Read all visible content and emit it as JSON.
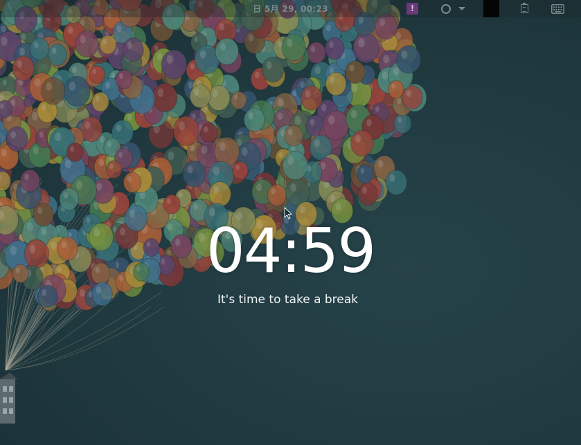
{
  "topbar": {
    "datetime": "日 5月 29, 00:23",
    "alert_icon_text": "!",
    "icons": [
      "alert-icon",
      "circle-status-icon",
      "chevron-down-icon",
      "clipboard-icon",
      "keyboard-icon"
    ]
  },
  "break_screen": {
    "timer": "04:59",
    "message": "It's time to take a break"
  },
  "colors": {
    "background": "#213d43",
    "timer_text": "#ffffff",
    "alert_badge": "#6a3a78"
  }
}
